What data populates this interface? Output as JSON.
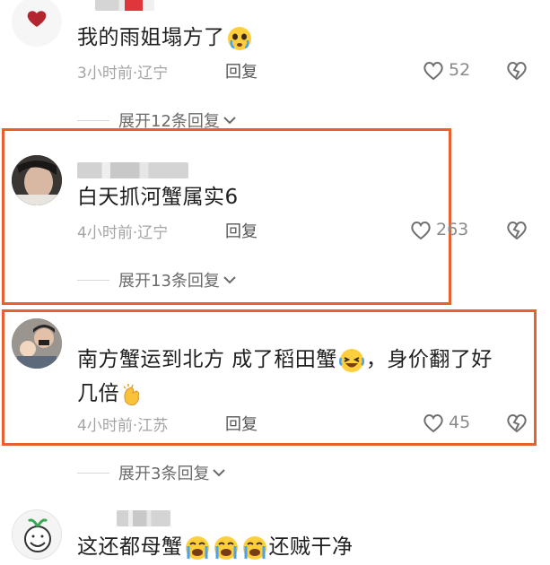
{
  "comments": [
    {
      "text": "我的雨姐塌方了",
      "emojis": [
        "crying-face"
      ],
      "time_location": "3小时前·辽宁",
      "reply_label": "回复",
      "like_count": "52",
      "expand_label": "展开12条回复",
      "highlighted": false
    },
    {
      "text": "白天抓河蟹属实6",
      "time_location": "4小时前·辽宁",
      "reply_label": "回复",
      "like_count": "263",
      "expand_label": "展开13条回复",
      "highlighted": true
    },
    {
      "text_part1": "南方蟹运到北方  成了稻田蟹",
      "text_part2": "，身价翻了好",
      "text_part3": "几倍",
      "emojis": [
        "laughing-crying-face",
        "clapping-hands"
      ],
      "time_location": "4小时前·江苏",
      "reply_label": "回复",
      "like_count": "45",
      "expand_label": "展开3条回复",
      "highlighted": true
    },
    {
      "text_part1": "这还都母蟹",
      "text_part2": "还贼干净",
      "emojis": [
        "crying-face",
        "crying-face",
        "crying-face"
      ],
      "highlighted": false
    }
  ],
  "colors": {
    "highlight_border": "#e8602d",
    "meta_text": "#a4a4a4",
    "content_text": "#1f1f1f"
  },
  "icons": [
    "heart-outline-icon",
    "broken-heart-icon",
    "chevron-down-icon"
  ]
}
